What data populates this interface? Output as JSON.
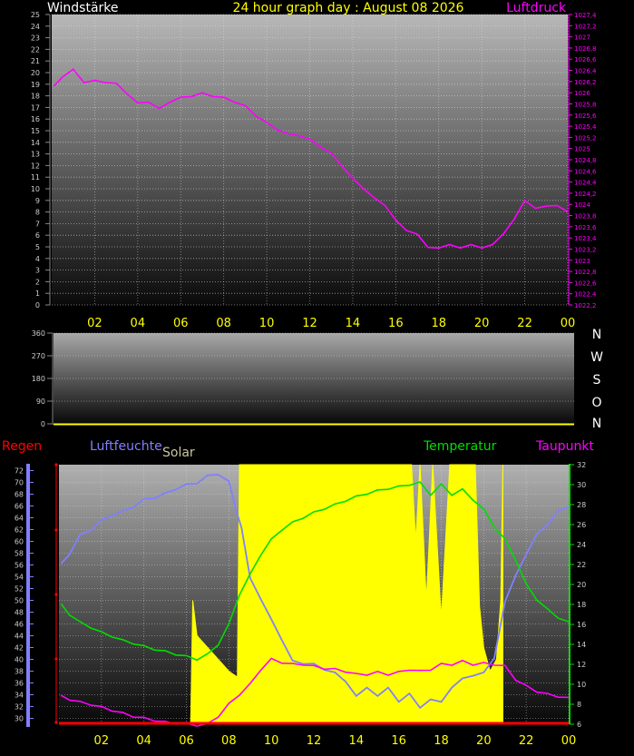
{
  "header": {
    "left_label": "Windstärke",
    "title": "24 hour graph day : August 08 2026",
    "right_label": "Luftdruck"
  },
  "compass": [
    "N",
    "W",
    "S",
    "O",
    "N"
  ],
  "bottom_labels": {
    "regen": "Regen",
    "luftfeuchte": "Luftfeuchte",
    "solar": "Solar",
    "temperatur": "Temperatur",
    "taupunkt": "Taupunkt"
  },
  "colors": {
    "pressure": "#ff00ff",
    "humidity": "#8080ff",
    "solar": "#ffff00",
    "temperature": "#00dd00",
    "dewpoint": "#ff00ff",
    "rain": "#ff0000",
    "x_ticks": "#ffff00"
  },
  "chart_data": [
    {
      "type": "line",
      "title": "24 hour graph day : August 08 2026",
      "x_tick_labels": [
        "02",
        "04",
        "06",
        "08",
        "10",
        "12",
        "14",
        "16",
        "18",
        "20",
        "22",
        "00"
      ],
      "left_axis": {
        "label": "Windstärke",
        "ylim": [
          0,
          25
        ],
        "ticks": [
          0,
          1,
          2,
          3,
          4,
          5,
          6,
          7,
          8,
          9,
          10,
          11,
          12,
          13,
          14,
          15,
          16,
          17,
          18,
          19,
          20,
          21,
          22,
          23,
          24,
          25
        ]
      },
      "right_axis": {
        "label": "Luftdruck",
        "ylim": [
          1022.2,
          1027.4
        ],
        "tick_labels": [
          "1022,2",
          "1022,4",
          "1022,6",
          "1022,8",
          "1023",
          "1023,2",
          "1023,4",
          "1023,6",
          "1023,8",
          "1024",
          "1024,2",
          "1024,4",
          "1024,6",
          "1024,8",
          "1025",
          "1025,2",
          "1025,4",
          "1025,6",
          "1025,8",
          "1026",
          "1026,2",
          "1026,4",
          "1026,6",
          "1026,8",
          "1027",
          "1027,2",
          "1027,4"
        ]
      },
      "series": [
        {
          "name": "Luftdruck",
          "x": [
            0.1,
            0.5,
            1.0,
            1.5,
            2.0,
            2.5,
            3.0,
            3.5,
            4.0,
            4.5,
            5.0,
            5.5,
            6.0,
            6.5,
            7.0,
            7.5,
            8.0,
            8.5,
            9.0,
            9.5,
            10.0,
            10.5,
            11.0,
            11.5,
            12.0,
            12.5,
            13.0,
            13.5,
            14.0,
            14.5,
            15.0,
            15.5,
            16.0,
            16.5,
            17.0,
            17.5,
            18.0,
            18.5,
            19.0,
            19.5,
            20.0,
            20.5,
            21.0,
            21.5,
            22.0,
            22.5,
            23.0,
            23.5,
            24.0
          ],
          "values": [
            1026.1,
            1026.3,
            1026.4,
            1026.2,
            1026.2,
            1026.2,
            1026.15,
            1026.0,
            1025.8,
            1025.85,
            1025.7,
            1025.85,
            1025.9,
            1025.95,
            1025.98,
            1025.95,
            1025.9,
            1025.85,
            1025.75,
            1025.6,
            1025.45,
            1025.35,
            1025.25,
            1025.25,
            1025.15,
            1025.05,
            1024.9,
            1024.7,
            1024.45,
            1024.3,
            1024.1,
            1024.0,
            1023.7,
            1023.55,
            1023.45,
            1023.25,
            1023.2,
            1023.3,
            1023.2,
            1023.3,
            1023.2,
            1023.3,
            1023.45,
            1023.75,
            1024.05,
            1023.95,
            1023.95,
            1024.0,
            1023.85
          ]
        }
      ]
    },
    {
      "type": "line",
      "x_tick_labels": [],
      "left_axis": {
        "ylim": [
          0,
          360
        ],
        "ticks": [
          0,
          90,
          180,
          270,
          360
        ]
      },
      "series": []
    },
    {
      "type": "line",
      "x_tick_labels": [
        "02",
        "04",
        "06",
        "08",
        "10",
        "12",
        "14",
        "16",
        "18",
        "20",
        "22",
        "00"
      ],
      "left_axis": {
        "label": "Luftfeuchte",
        "ylim": [
          29,
          73
        ],
        "ticks": [
          30,
          32,
          34,
          36,
          38,
          40,
          42,
          44,
          46,
          48,
          50,
          52,
          54,
          56,
          58,
          60,
          62,
          64,
          66,
          68,
          70,
          72
        ]
      },
      "right_axis": {
        "label": "Temperatur",
        "ylim": [
          6,
          32
        ],
        "ticks": [
          6,
          8,
          10,
          12,
          14,
          16,
          18,
          20,
          22,
          24,
          26,
          28,
          30,
          32
        ]
      },
      "series": [
        {
          "name": "Luftfeuchte",
          "axis": "left",
          "x": [
            0.1,
            0.5,
            1.0,
            1.5,
            2.0,
            2.5,
            3.0,
            3.5,
            4.0,
            4.5,
            5.0,
            5.5,
            6.0,
            6.5,
            7.0,
            7.5,
            8.0,
            8.3,
            8.6,
            9.0,
            9.5,
            10.0,
            10.5,
            11.0,
            11.5,
            12.0,
            12.5,
            13.0,
            13.5,
            14.0,
            14.5,
            15.0,
            15.5,
            16.0,
            16.5,
            17.0,
            17.5,
            18.0,
            18.5,
            19.0,
            19.5,
            20.0,
            20.5,
            21.0,
            21.5,
            22.0,
            22.5,
            23.0,
            23.5,
            24.0
          ],
          "values": [
            56,
            58,
            61,
            62,
            63.5,
            64.5,
            65,
            66,
            67,
            67.5,
            68,
            69,
            69.5,
            70,
            71,
            71.5,
            70,
            66,
            62,
            54,
            50,
            47,
            43,
            40,
            39,
            39.5,
            38,
            38,
            36,
            34,
            35,
            34,
            35,
            33,
            34,
            32,
            33,
            33,
            35,
            37,
            37,
            38,
            40,
            50,
            54,
            58,
            61,
            63,
            65,
            66
          ]
        },
        {
          "name": "Temperatur",
          "axis": "right",
          "x": [
            0.1,
            0.5,
            1.0,
            1.5,
            2.0,
            2.5,
            3.0,
            3.5,
            4.0,
            4.5,
            5.0,
            5.5,
            6.0,
            6.5,
            7.0,
            7.5,
            8.0,
            8.5,
            9.0,
            9.5,
            10.0,
            10.5,
            11.0,
            11.5,
            12.0,
            12.5,
            13.0,
            13.5,
            14.0,
            14.5,
            15.0,
            15.5,
            16.0,
            16.5,
            17.0,
            17.5,
            18.0,
            18.5,
            19.0,
            19.5,
            20.0,
            20.5,
            21.0,
            21.5,
            22.0,
            22.5,
            23.0,
            23.5,
            24.0
          ],
          "values": [
            18,
            17,
            16.2,
            15.7,
            15.2,
            14.8,
            14.4,
            14.1,
            13.8,
            13.5,
            13.3,
            13,
            12.8,
            12.5,
            13,
            14,
            16,
            19,
            21,
            23,
            24.5,
            25.5,
            26.2,
            26.7,
            27.2,
            27.6,
            28,
            28.4,
            28.8,
            29.1,
            29.4,
            29.6,
            29.8,
            30,
            30.2,
            29,
            30,
            29,
            29.5,
            28.5,
            27.5,
            25.8,
            24.5,
            22.5,
            20,
            18.5,
            17.5,
            16.7,
            16.2
          ]
        },
        {
          "name": "Taupunkt",
          "axis": "right",
          "x": [
            0.1,
            0.5,
            1.0,
            1.5,
            2.0,
            2.5,
            3.0,
            3.5,
            4.0,
            4.5,
            5.0,
            5.5,
            6.0,
            6.5,
            7.0,
            7.5,
            8.0,
            8.5,
            9.0,
            9.5,
            10.0,
            10.5,
            11.0,
            11.5,
            12.0,
            12.5,
            13.0,
            13.5,
            14.0,
            14.5,
            15.0,
            15.5,
            16.0,
            16.5,
            17.0,
            17.5,
            18.0,
            18.5,
            19.0,
            19.5,
            20.0,
            20.5,
            21.0,
            21.5,
            22.0,
            22.5,
            23.0,
            23.5,
            24.0
          ],
          "values": [
            8.8,
            8.5,
            8.2,
            8,
            7.7,
            7.4,
            7.1,
            6.8,
            6.6,
            6.4,
            6.2,
            6.1,
            6,
            5.9,
            6,
            6.8,
            8,
            9,
            10,
            11.5,
            12.5,
            12.2,
            12,
            12,
            11.8,
            11.6,
            11.5,
            11.3,
            11,
            11,
            11.2,
            11,
            11.2,
            11.5,
            11.3,
            11.5,
            12,
            12,
            12.3,
            12,
            12.1,
            12,
            11.8,
            10.5,
            9.8,
            9.3,
            9,
            8.8,
            8.6
          ]
        },
        {
          "name": "Solar",
          "axis": "left",
          "x": [
            6.2,
            6.3,
            6.5,
            7.0,
            7.5,
            8.0,
            8.4,
            8.5,
            8.6,
            9.0,
            10.0,
            12.0,
            14.0,
            16.0,
            16.6,
            16.8,
            17.0,
            17.3,
            17.6,
            18.0,
            18.4,
            18.8,
            19.2,
            19.6,
            19.8,
            20.0,
            20.3,
            20.6,
            20.8,
            20.9
          ],
          "values": [
            29,
            50,
            44,
            42,
            40,
            38,
            37,
            73,
            73,
            73,
            73,
            73,
            73,
            73,
            73,
            60,
            73,
            50,
            73,
            47,
            73,
            73,
            73,
            73,
            49,
            42,
            38,
            40,
            50,
            73
          ]
        },
        {
          "name": "Regen",
          "axis": "left",
          "x": [
            0,
            24
          ],
          "values": [
            0,
            0
          ]
        }
      ]
    }
  ]
}
